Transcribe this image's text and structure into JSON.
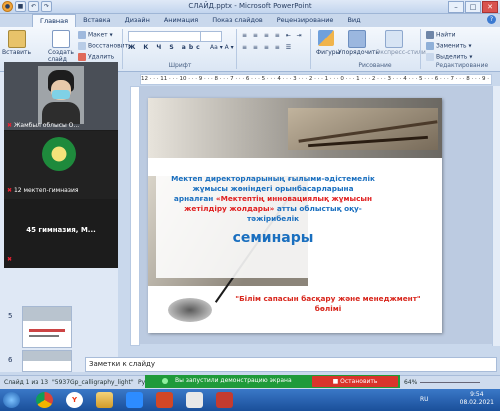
{
  "window": {
    "title": "СЛАЙД.pptx - Microsoft PowerPoint"
  },
  "ribbon_tabs": [
    "Главная",
    "Вставка",
    "Дизайн",
    "Анимация",
    "Показ слайдов",
    "Рецензирование",
    "Вид"
  ],
  "ribbon": {
    "paste": "Вставить",
    "create_slide": "Создать слайд",
    "layout": "Макет",
    "restore": "Восстановить",
    "delete": "Удалить",
    "font_group": "Шрифт",
    "shapes": "Фигуры",
    "arrange": "Упорядочить",
    "styles": "Экспресс-стили",
    "drawing_group": "Рисование",
    "find": "Найти",
    "replace": "Заменить",
    "select": "Выделить",
    "editing_group": "Редактирование"
  },
  "ruler_text": "12 · · · 11 · · · 10 · · · 9 · · · 8 · · · 7 · · · 6 · · · 5 · · · 4 · · · 3 · · · 2 · · · 1 · · · 0 · · · 1 · · · 2 · · · 3 · · · 4 · · · 5 · · · 6 · · · 7 · · · 8 · · · 9 · · · 10 · · · 11 · · · 12",
  "video_tiles": [
    {
      "label": "Жамбыл облысы О..."
    },
    {
      "label": "12 мектеп-гимназия"
    },
    {
      "label": "45 гимназия, М..."
    }
  ],
  "slide_numbers": [
    "5",
    "6"
  ],
  "slide": {
    "heading_line1": "Мектеп директорларының ғылыми-әдістемелік",
    "heading_line2": "жұмысы жөніндегі орынбасарларына",
    "heading_line3": "арналған ",
    "heading_highlight1": "«Мектептің инновациялық жұмысын",
    "heading_highlight2": "жетілдіру жолдары»",
    "heading_line4": " атты облыстық оқу-",
    "heading_line5": "тәжірибелік",
    "title_big": "семинары",
    "footer_line1": "\"Білім сапасын басқару және менеджмент\"",
    "footer_line2": "бөлімі"
  },
  "notes_placeholder": "Заметки к слайду",
  "status": {
    "slide_info": "Слайд 1 из 13",
    "theme": "\"5937Gp_calligraphy_light\"",
    "lang": "Рус",
    "share_text": "Вы запустили демонстрацию экрана",
    "stop_button": "Остановить демонстрацию",
    "zoom": "64%"
  },
  "taskbar": {
    "lang": "RU",
    "time": "9:54",
    "date": "08.02.2021"
  },
  "colors": {
    "slide_title_blue": "#1a6fbf",
    "slide_highlight_red": "#e02020",
    "footer_red": "#d8261c",
    "share_green": "#1f9a3a",
    "stop_red": "#d9342b"
  }
}
